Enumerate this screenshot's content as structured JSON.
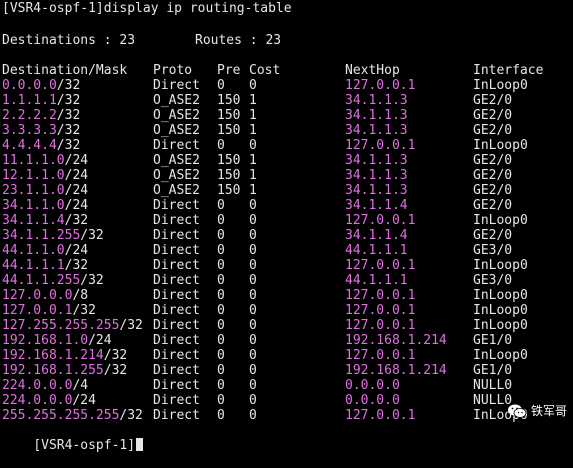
{
  "terminal": {
    "command_line": "[VSR4-ospf-1]display ip routing-table",
    "summary": {
      "destinations": "Destinations : 23",
      "routes": "Routes : 23"
    },
    "headers": {
      "destination": "Destination/Mask",
      "proto": "Proto",
      "pre": "Pre",
      "cost": "Cost",
      "nexthop": "NextHop",
      "interface": "Interface"
    },
    "rows": [
      {
        "ip": "0.0.0.0",
        "mask": "/32",
        "proto": "Direct",
        "pre": "0",
        "cost": "0",
        "nexthop": "127.0.0.1",
        "iface": "InLoop0"
      },
      {
        "ip": "1.1.1.1",
        "mask": "/32",
        "proto": "O_ASE2",
        "pre": "150",
        "cost": "1",
        "nexthop": "34.1.1.3",
        "iface": "GE2/0"
      },
      {
        "ip": "2.2.2.2",
        "mask": "/32",
        "proto": "O_ASE2",
        "pre": "150",
        "cost": "1",
        "nexthop": "34.1.1.3",
        "iface": "GE2/0"
      },
      {
        "ip": "3.3.3.3",
        "mask": "/32",
        "proto": "O_ASE2",
        "pre": "150",
        "cost": "1",
        "nexthop": "34.1.1.3",
        "iface": "GE2/0"
      },
      {
        "ip": "4.4.4.4",
        "mask": "/32",
        "proto": "Direct",
        "pre": "0",
        "cost": "0",
        "nexthop": "127.0.0.1",
        "iface": "InLoop0"
      },
      {
        "ip": "11.1.1.0",
        "mask": "/24",
        "proto": "O_ASE2",
        "pre": "150",
        "cost": "1",
        "nexthop": "34.1.1.3",
        "iface": "GE2/0"
      },
      {
        "ip": "12.1.1.0",
        "mask": "/24",
        "proto": "O_ASE2",
        "pre": "150",
        "cost": "1",
        "nexthop": "34.1.1.3",
        "iface": "GE2/0"
      },
      {
        "ip": "23.1.1.0",
        "mask": "/24",
        "proto": "O_ASE2",
        "pre": "150",
        "cost": "1",
        "nexthop": "34.1.1.3",
        "iface": "GE2/0"
      },
      {
        "ip": "34.1.1.0",
        "mask": "/24",
        "proto": "Direct",
        "pre": "0",
        "cost": "0",
        "nexthop": "34.1.1.4",
        "iface": "GE2/0"
      },
      {
        "ip": "34.1.1.4",
        "mask": "/32",
        "proto": "Direct",
        "pre": "0",
        "cost": "0",
        "nexthop": "127.0.0.1",
        "iface": "InLoop0"
      },
      {
        "ip": "34.1.1.255",
        "mask": "/32",
        "proto": "Direct",
        "pre": "0",
        "cost": "0",
        "nexthop": "34.1.1.4",
        "iface": "GE2/0"
      },
      {
        "ip": "44.1.1.0",
        "mask": "/24",
        "proto": "Direct",
        "pre": "0",
        "cost": "0",
        "nexthop": "44.1.1.1",
        "iface": "GE3/0"
      },
      {
        "ip": "44.1.1.1",
        "mask": "/32",
        "proto": "Direct",
        "pre": "0",
        "cost": "0",
        "nexthop": "127.0.0.1",
        "iface": "InLoop0"
      },
      {
        "ip": "44.1.1.255",
        "mask": "/32",
        "proto": "Direct",
        "pre": "0",
        "cost": "0",
        "nexthop": "44.1.1.1",
        "iface": "GE3/0"
      },
      {
        "ip": "127.0.0.0",
        "mask": "/8",
        "proto": "Direct",
        "pre": "0",
        "cost": "0",
        "nexthop": "127.0.0.1",
        "iface": "InLoop0"
      },
      {
        "ip": "127.0.0.1",
        "mask": "/32",
        "proto": "Direct",
        "pre": "0",
        "cost": "0",
        "nexthop": "127.0.0.1",
        "iface": "InLoop0"
      },
      {
        "ip": "127.255.255.255",
        "mask": "/32",
        "proto": "Direct",
        "pre": "0",
        "cost": "0",
        "nexthop": "127.0.0.1",
        "iface": "InLoop0"
      },
      {
        "ip": "192.168.1.0",
        "mask": "/24",
        "proto": "Direct",
        "pre": "0",
        "cost": "0",
        "nexthop": "192.168.1.214",
        "iface": "GE1/0"
      },
      {
        "ip": "192.168.1.214",
        "mask": "/32",
        "proto": "Direct",
        "pre": "0",
        "cost": "0",
        "nexthop": "127.0.0.1",
        "iface": "InLoop0"
      },
      {
        "ip": "192.168.1.255",
        "mask": "/32",
        "proto": "Direct",
        "pre": "0",
        "cost": "0",
        "nexthop": "192.168.1.214",
        "iface": "GE1/0"
      },
      {
        "ip": "224.0.0.0",
        "mask": "/4",
        "proto": "Direct",
        "pre": "0",
        "cost": "0",
        "nexthop": "0.0.0.0",
        "iface": "NULL0"
      },
      {
        "ip": "224.0.0.0",
        "mask": "/24",
        "proto": "Direct",
        "pre": "0",
        "cost": "0",
        "nexthop": "0.0.0.0",
        "iface": "NULL0"
      },
      {
        "ip": "255.255.255.255",
        "mask": "/32",
        "proto": "Direct",
        "pre": "0",
        "cost": "0",
        "nexthop": "127.0.0.1",
        "iface": "InLoop0"
      }
    ],
    "prompt": "[VSR4-ospf-1]"
  },
  "colors": {
    "ip": "#e070e0",
    "text": "#e6e6e6",
    "background": "#000000"
  },
  "watermark": {
    "text": "铁军哥",
    "icon": "wechat-logo-icon"
  }
}
